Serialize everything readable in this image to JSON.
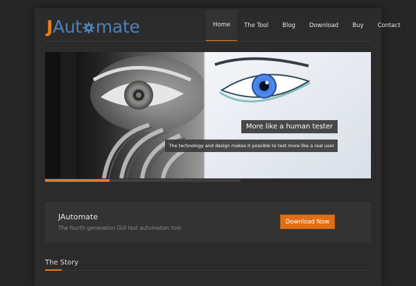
{
  "brand": {
    "logo_j": "J",
    "logo_au": "Aut",
    "logo_mate": "mate",
    "accent_color": "#e67e1e",
    "logo_color": "#4f7fb7"
  },
  "nav": {
    "items": [
      {
        "label": "Home"
      },
      {
        "label": "The Tool"
      },
      {
        "label": "Blog"
      },
      {
        "label": "Download"
      },
      {
        "label": "Buy"
      },
      {
        "label": "Contact"
      }
    ],
    "active": "Home"
  },
  "slider": {
    "caption": "More like a human tester",
    "subcaption": "The technology and design makes it possible to test more like a real user",
    "progress": 0.33
  },
  "cta": {
    "title": "JAutomate",
    "subtitle": "The fourth generation GUI test automation tool",
    "button_label": "Download Now",
    "button_color": "#e26e12"
  },
  "story": {
    "title": "The Story"
  }
}
